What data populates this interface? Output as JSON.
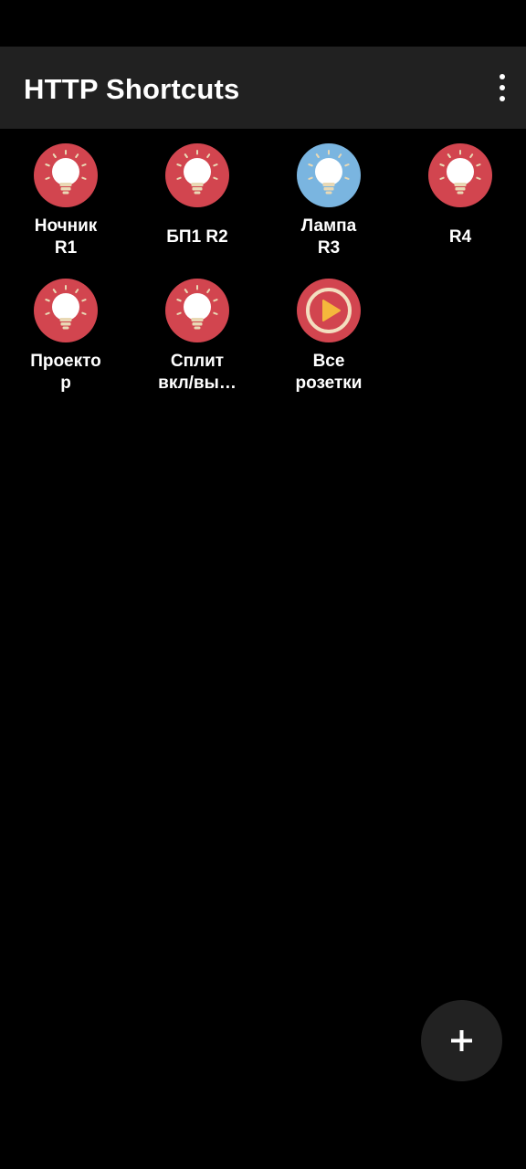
{
  "app_bar": {
    "title": "HTTP Shortcuts",
    "menu_icon": "more-vert-icon"
  },
  "colors": {
    "red": "#D2454F",
    "blue": "#7AB5E0",
    "bulb": "#FFFFFF",
    "bulb_base": "#E9D9B5",
    "play_ring": "#F3DFC0",
    "play_triangle": "#F5B73C",
    "app_bar": "#212121",
    "background": "#000000",
    "fab": "#222222"
  },
  "shortcuts": [
    {
      "label": "Ночник\nR1",
      "icon": "lightbulb-icon",
      "color": "red"
    },
    {
      "label": "БП1 R2",
      "icon": "lightbulb-icon",
      "color": "red"
    },
    {
      "label": "Лампа\nR3",
      "icon": "lightbulb-icon",
      "color": "blue"
    },
    {
      "label": "R4",
      "icon": "lightbulb-icon",
      "color": "red"
    },
    {
      "label": "Проекто\nр",
      "icon": "lightbulb-icon",
      "color": "red"
    },
    {
      "label": "Сплит\nвкл/вы…",
      "icon": "lightbulb-icon",
      "color": "red"
    },
    {
      "label": "Все\nрозетки",
      "icon": "play-icon",
      "color": "red"
    }
  ],
  "fab": {
    "icon": "plus-icon"
  }
}
